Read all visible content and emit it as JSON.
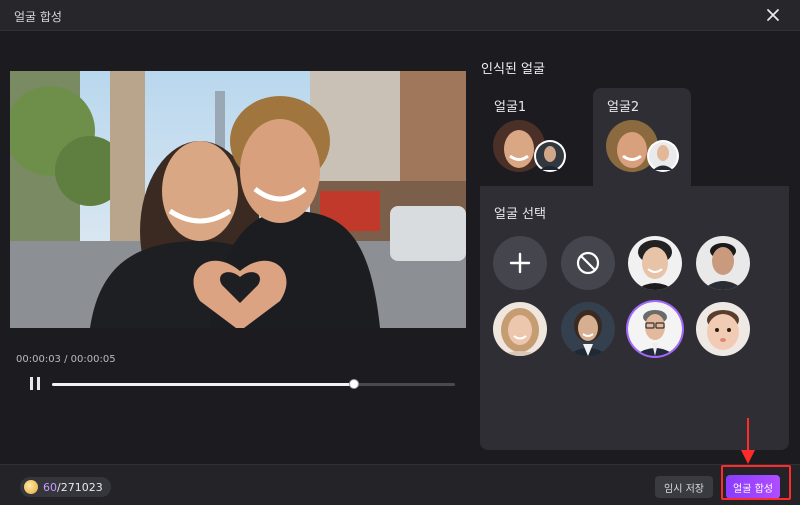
{
  "window": {
    "title": "얼굴 합성"
  },
  "player": {
    "time": "00:00:03 / 00:00:05",
    "progress": 0.75
  },
  "recognized": {
    "title": "인식된 얼굴",
    "tabs": [
      {
        "label": "얼굴1",
        "active": false
      },
      {
        "label": "얼굴2",
        "active": true
      }
    ]
  },
  "selection": {
    "title": "얼굴 선택",
    "items": [
      {
        "name": "add-face-button",
        "icon": "plus-icon",
        "kind": "action"
      },
      {
        "name": "no-face-button",
        "icon": "no-entry-icon",
        "kind": "action"
      },
      {
        "name": "face-option-young-man",
        "kind": "face"
      },
      {
        "name": "face-option-short-hair-man",
        "kind": "face"
      },
      {
        "name": "face-option-blonde-woman",
        "kind": "face"
      },
      {
        "name": "face-option-business-woman",
        "kind": "face"
      },
      {
        "name": "face-option-glasses-man",
        "kind": "face",
        "selected": true
      },
      {
        "name": "face-option-baby",
        "kind": "face"
      }
    ]
  },
  "footer": {
    "credits_used": "60",
    "credits_total": "/271023",
    "save_label": "임시 저장",
    "swap_label": "얼굴 합성"
  },
  "colors": {
    "accent": "#a366ff",
    "annotation": "#ff2a2a",
    "background": "#1c1c20"
  }
}
